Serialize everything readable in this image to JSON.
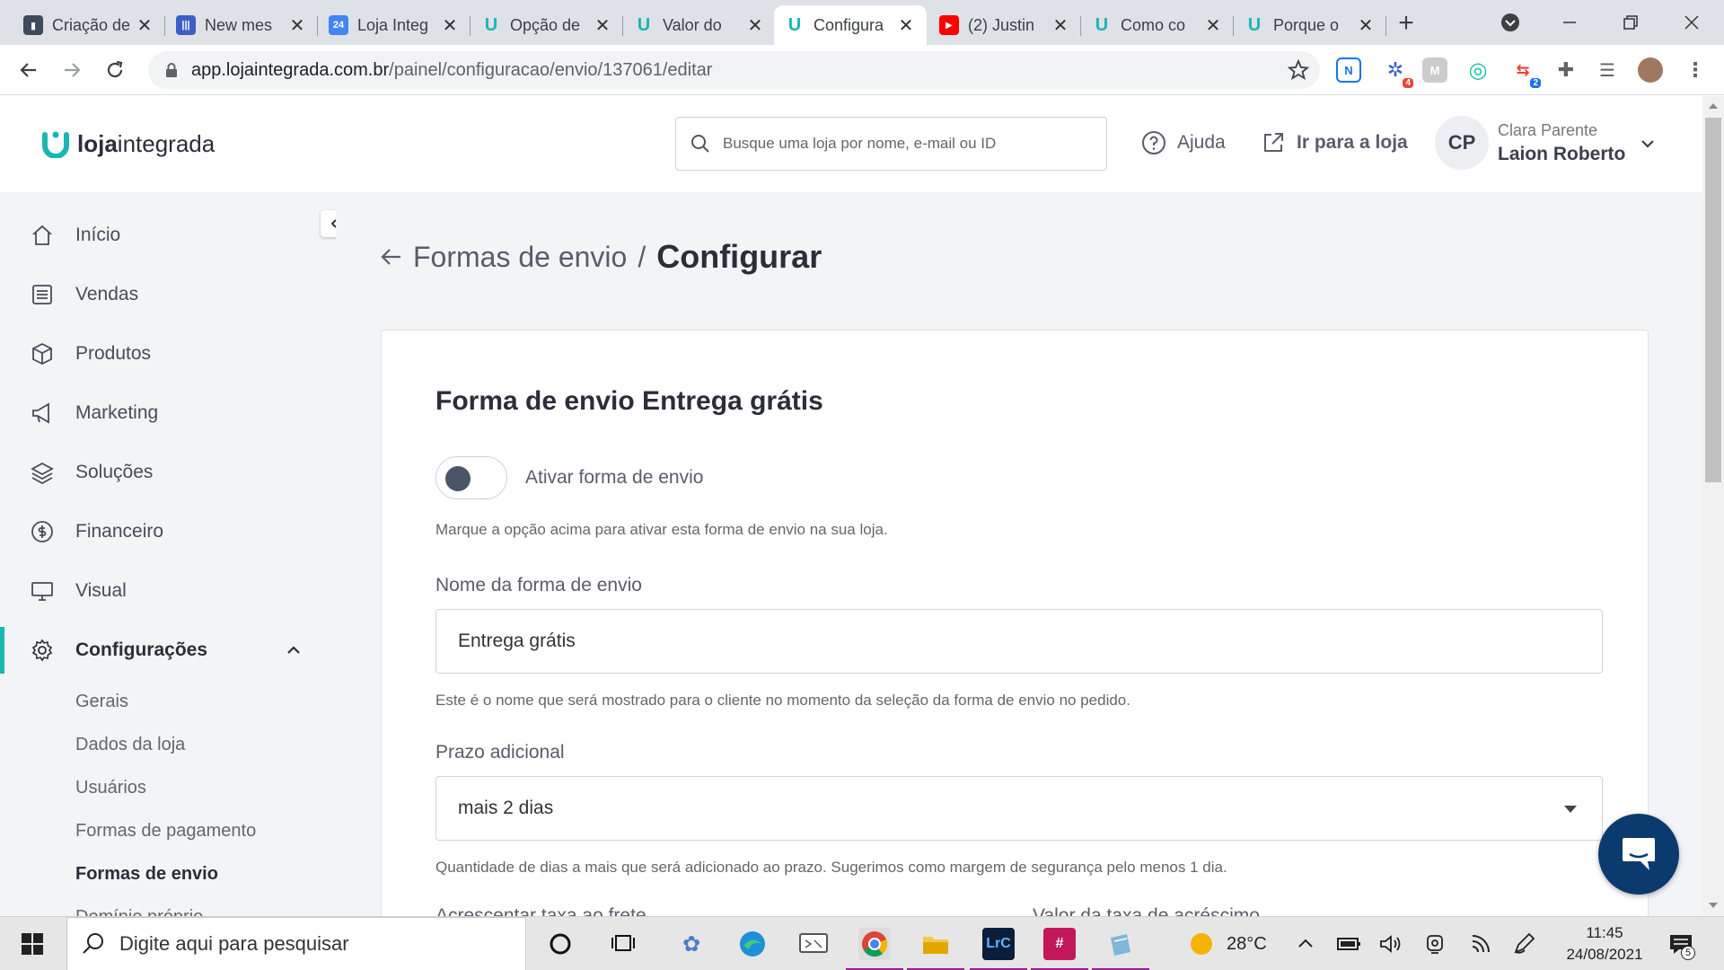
{
  "browser": {
    "tabs": [
      {
        "title": "Criação de",
        "color": "#3d4b5c"
      },
      {
        "title": "New mes",
        "color": "#3b5fc4"
      },
      {
        "title": "Loja Integ",
        "color": "#4285f4"
      },
      {
        "title": "Opção de",
        "color": "#1bb6b1"
      },
      {
        "title": "Valor do",
        "color": "#1bb6b1"
      },
      {
        "title": "Configura",
        "color": "#1bb6b1"
      },
      {
        "title": "(2) Justin",
        "color": "#ff0000"
      },
      {
        "title": "Como co",
        "color": "#1bb6b1"
      },
      {
        "title": "Porque o",
        "color": "#1bb6b1"
      }
    ],
    "calendar_fav_text": "24",
    "active_tab_index": 5,
    "url_host": "app.lojaintegrada.com.br",
    "url_path": "/painel/configuracao/envio/137061/editar",
    "ext_badge_1": "4",
    "ext_badge_2": "2"
  },
  "header": {
    "logo_bold": "loja",
    "logo_regular": "integrada",
    "search_placeholder": "Busque uma loja por nome, e-mail ou ID",
    "help_label": "Ajuda",
    "store_link_label": "Ir para a loja",
    "avatar_initials": "CP",
    "user_name": "Clara Parente",
    "store_name": "Laion Roberto"
  },
  "sidebar": {
    "items": [
      {
        "label": "Início",
        "icon": "home-icon"
      },
      {
        "label": "Vendas",
        "icon": "list-icon"
      },
      {
        "label": "Produtos",
        "icon": "box-icon"
      },
      {
        "label": "Marketing",
        "icon": "megaphone-icon"
      },
      {
        "label": "Soluções",
        "icon": "layers-icon"
      },
      {
        "label": "Financeiro",
        "icon": "dollar-icon"
      },
      {
        "label": "Visual",
        "icon": "monitor-icon"
      },
      {
        "label": "Configurações",
        "icon": "gear-icon"
      }
    ],
    "sub_items": [
      "Gerais",
      "Dados da loja",
      "Usuários",
      "Formas de pagamento",
      "Formas de envio",
      "Domínio próprio"
    ],
    "active_sub": "Formas de envio"
  },
  "breadcrumb": {
    "parent": "Formas de envio",
    "separator": "/",
    "current": "Configurar"
  },
  "form": {
    "title": "Forma de envio Entrega grátis",
    "toggle_label": "Ativar forma de envio",
    "toggle_help": "Marque a opção acima para ativar esta forma de envio na sua loja.",
    "name_label": "Nome da forma de envio",
    "name_value": "Entrega grátis",
    "name_help": "Este é o nome que será mostrado para o cliente no momento da seleção da forma de envio no pedido.",
    "deadline_label": "Prazo adicional",
    "deadline_value": "mais 2 dias",
    "deadline_help": "Quantidade de dias a mais que será adicionado ao prazo. Sugerimos como margem de segurança pelo menos 1 dia.",
    "fee_label": "Acrescentar taxa ao frete",
    "fee_value_label": "Valor da taxa de acréscimo"
  },
  "taskbar": {
    "search_placeholder": "Digite aqui para pesquisar",
    "lrc_label": "LrC",
    "weather": "28°C",
    "time": "11:45",
    "date": "24/08/2021",
    "notifications": "5"
  },
  "colors": {
    "accent": "#1bb6b1",
    "chat": "#0b3b6e"
  }
}
